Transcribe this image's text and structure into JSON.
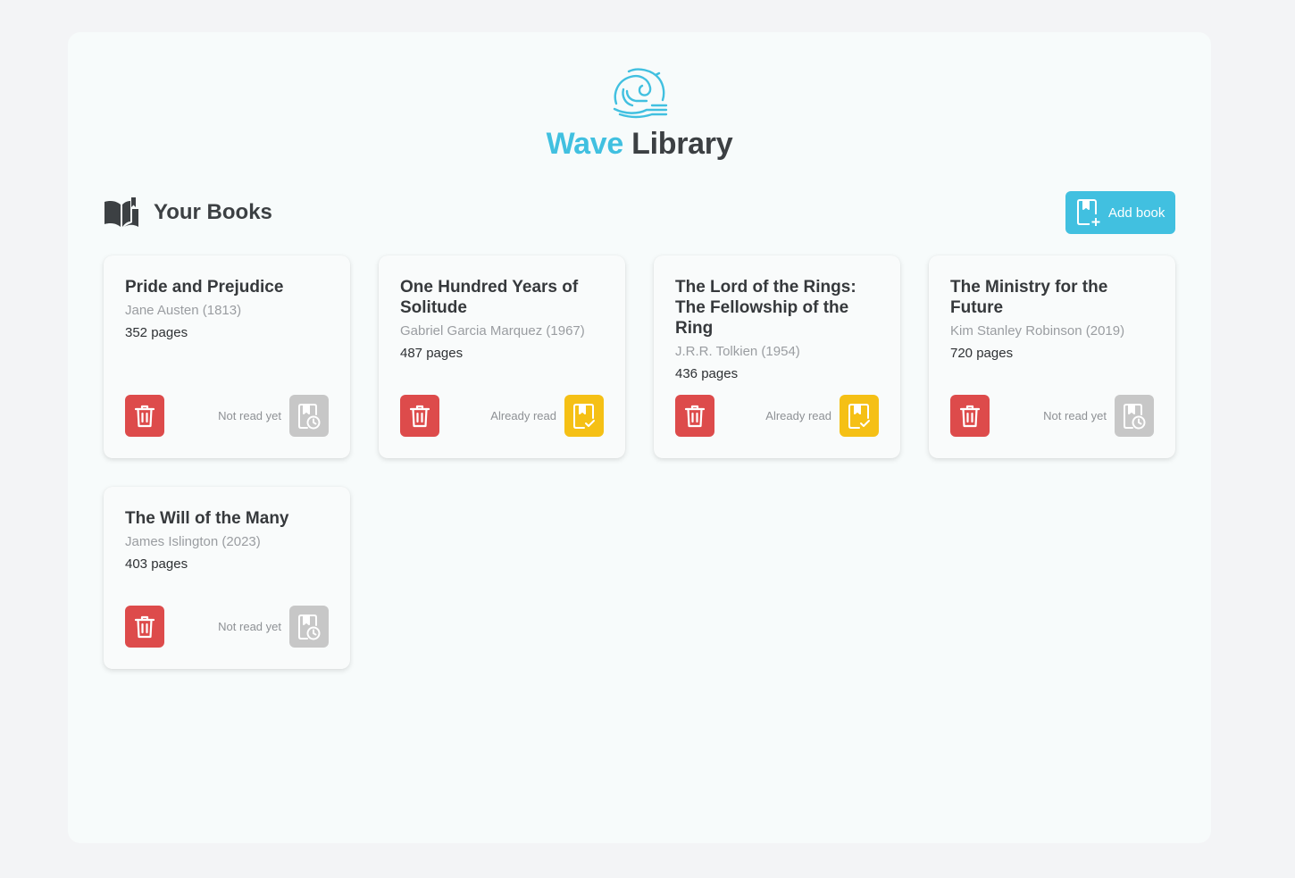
{
  "brand": {
    "title_accent": "Wave",
    "title_rest": "Library",
    "logo_icon": "wave-logo-icon",
    "accent_color": "#41c0e0"
  },
  "section": {
    "title": "Your Books",
    "icon": "open-book-icon"
  },
  "toolbar": {
    "add_label": "Add book",
    "add_icon": "add-book-icon"
  },
  "colors": {
    "delete": "#dd4b4b",
    "read": "#f5c015",
    "unread": "#c7c7c7"
  },
  "books": [
    {
      "title": "Pride and Prejudice",
      "author": "Jane Austen (1813)",
      "pages": "352 pages",
      "status": "Not read yet",
      "read": false
    },
    {
      "title": "One Hundred Years of Solitude",
      "author": "Gabriel Garcia Marquez (1967)",
      "pages": "487 pages",
      "status": "Already read",
      "read": true
    },
    {
      "title": "The Lord of the Rings: The Fellowship of the Ring",
      "author": "J.R.R. Tolkien (1954)",
      "pages": "436 pages",
      "status": "Already read",
      "read": true
    },
    {
      "title": "The Ministry for the Future",
      "author": "Kim Stanley Robinson (2019)",
      "pages": "720 pages",
      "status": "Not read yet",
      "read": false
    },
    {
      "title": "The Will of the Many",
      "author": "James Islington (2023)",
      "pages": "403 pages",
      "status": "Not read yet",
      "read": false
    }
  ]
}
